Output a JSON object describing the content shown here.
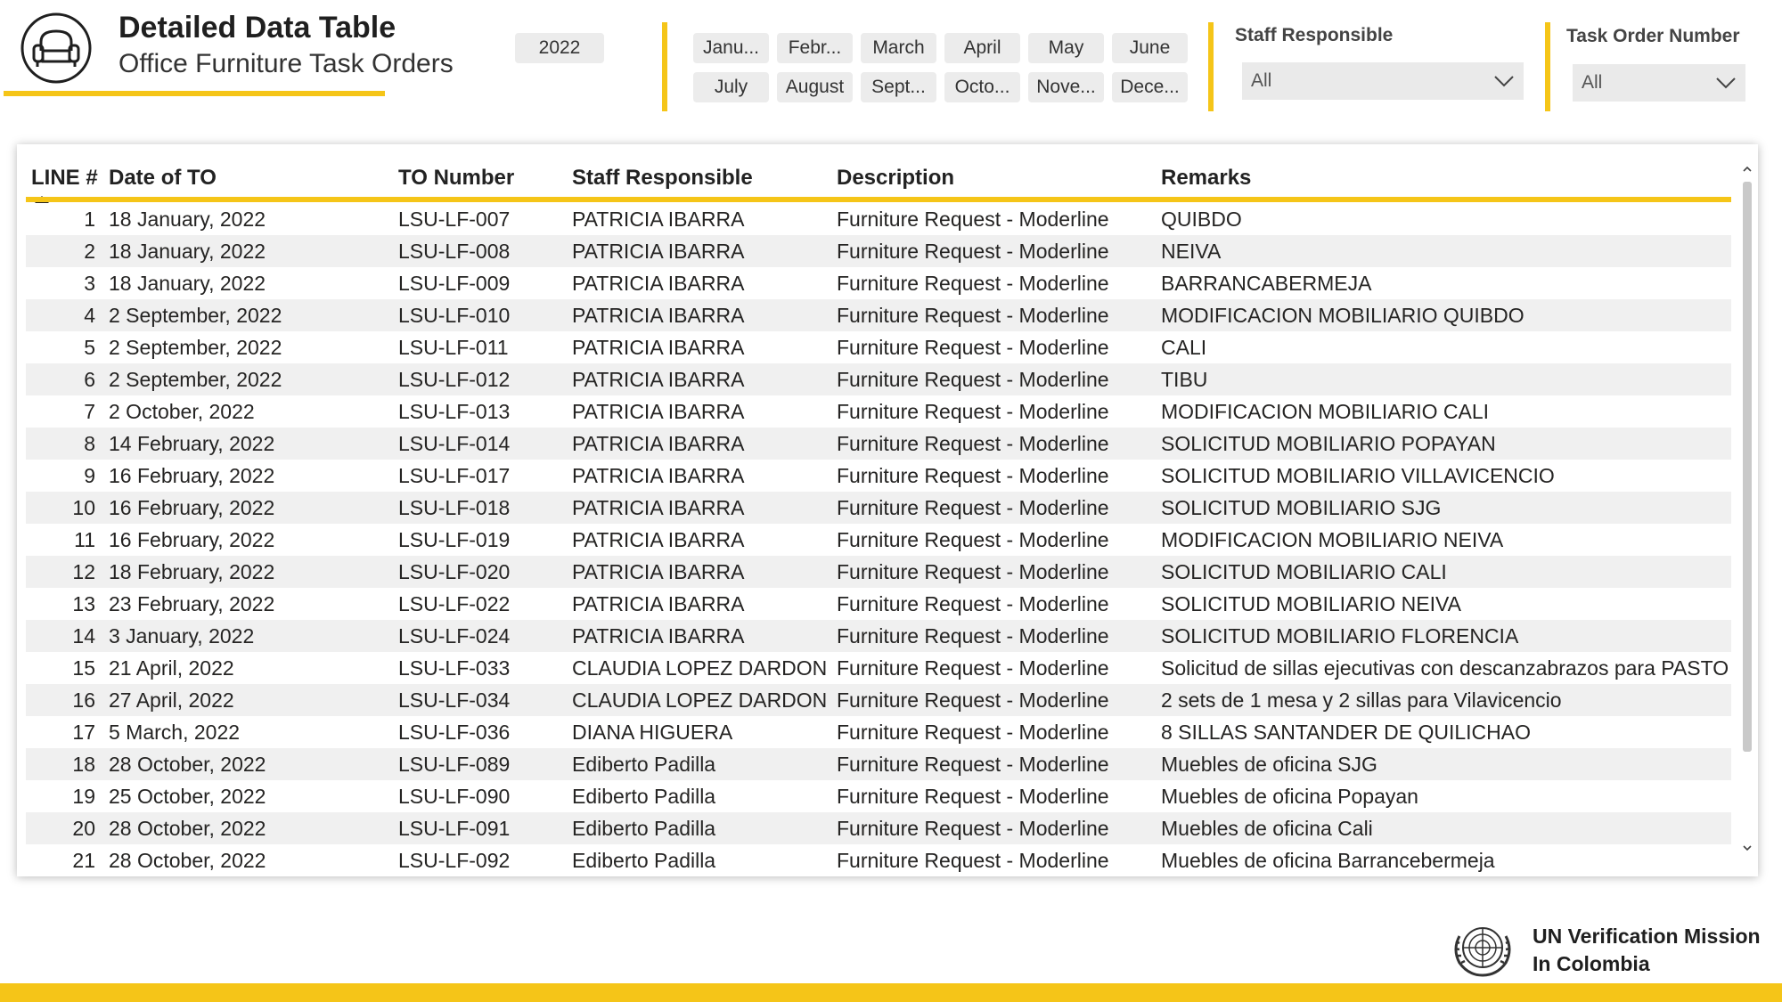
{
  "header": {
    "title": "Detailed Data Table",
    "subtitle": "Office Furniture Task Orders",
    "logo_icon": "armchair-icon"
  },
  "filters": {
    "year": "2022",
    "months": [
      "Janu...",
      "Febr...",
      "March",
      "April",
      "May",
      "June",
      "July",
      "August",
      "Sept...",
      "Octo...",
      "Nove...",
      "Dece..."
    ],
    "staff": {
      "title": "Staff Responsible",
      "value": "All"
    },
    "task_order": {
      "title": "Task Order Number",
      "value": "All"
    }
  },
  "table": {
    "columns": [
      "LINE #",
      "Date of TO",
      "TO Number",
      "Staff Responsible",
      "Description",
      "Remarks"
    ],
    "sort_column": "LINE #",
    "sort_direction": "ascending",
    "rows": [
      [
        "1",
        "18 January, 2022",
        "LSU-LF-007",
        "PATRICIA IBARRA",
        "Furniture Request - Moderline",
        "QUIBDO"
      ],
      [
        "2",
        "18 January, 2022",
        "LSU-LF-008",
        "PATRICIA IBARRA",
        "Furniture Request - Moderline",
        "NEIVA"
      ],
      [
        "3",
        "18 January, 2022",
        "LSU-LF-009",
        "PATRICIA IBARRA",
        "Furniture Request - Moderline",
        "BARRANCABERMEJA"
      ],
      [
        "4",
        "2 September, 2022",
        "LSU-LF-010",
        "PATRICIA IBARRA",
        "Furniture Request - Moderline",
        "MODIFICACION MOBILIARIO QUIBDO"
      ],
      [
        "5",
        "2 September, 2022",
        "LSU-LF-011",
        "PATRICIA IBARRA",
        "Furniture Request - Moderline",
        "CALI"
      ],
      [
        "6",
        "2 September, 2022",
        "LSU-LF-012",
        "PATRICIA IBARRA",
        "Furniture Request - Moderline",
        "TIBU"
      ],
      [
        "7",
        "2 October, 2022",
        "LSU-LF-013",
        "PATRICIA IBARRA",
        "Furniture Request - Moderline",
        "MODIFICACION MOBILIARIO CALI"
      ],
      [
        "8",
        "14 February, 2022",
        "LSU-LF-014",
        "PATRICIA IBARRA",
        "Furniture Request - Moderline",
        "SOLICITUD MOBILIARIO POPAYAN"
      ],
      [
        "9",
        "16 February, 2022",
        "LSU-LF-017",
        "PATRICIA IBARRA",
        "Furniture Request - Moderline",
        "SOLICITUD MOBILIARIO VILLAVICENCIO"
      ],
      [
        "10",
        "16 February, 2022",
        "LSU-LF-018",
        "PATRICIA IBARRA",
        "Furniture Request - Moderline",
        "SOLICITUD MOBILIARIO SJG"
      ],
      [
        "11",
        "16 February, 2022",
        "LSU-LF-019",
        "PATRICIA IBARRA",
        "Furniture Request - Moderline",
        "MODIFICACION MOBILIARIO NEIVA"
      ],
      [
        "12",
        "18 February, 2022",
        "LSU-LF-020",
        "PATRICIA IBARRA",
        "Furniture Request - Moderline",
        "SOLICITUD MOBILIARIO CALI"
      ],
      [
        "13",
        "23 February, 2022",
        "LSU-LF-022",
        "PATRICIA IBARRA",
        "Furniture Request - Moderline",
        "SOLICITUD MOBILIARIO NEIVA"
      ],
      [
        "14",
        "3 January, 2022",
        "LSU-LF-024",
        "PATRICIA IBARRA",
        "Furniture Request - Moderline",
        "SOLICITUD MOBILIARIO FLORENCIA"
      ],
      [
        "15",
        "21 April, 2022",
        "LSU-LF-033",
        "CLAUDIA LOPEZ DARDON",
        "Furniture Request - Moderline",
        "Solicitud de sillas ejecutivas con descanzabrazos para PASTO"
      ],
      [
        "16",
        "27 April, 2022",
        "LSU-LF-034",
        "CLAUDIA LOPEZ DARDON",
        "Furniture Request - Moderline",
        "2 sets de 1 mesa y 2 sillas para Vilavicencio"
      ],
      [
        "17",
        "5 March, 2022",
        "LSU-LF-036",
        "DIANA HIGUERA",
        "Furniture Request - Moderline",
        "8 SILLAS SANTANDER DE QUILICHAO"
      ],
      [
        "18",
        "28 October, 2022",
        "LSU-LF-089",
        "Ediberto Padilla",
        "Furniture Request - Moderline",
        "Muebles de oficina SJG"
      ],
      [
        "19",
        "25 October, 2022",
        "LSU-LF-090",
        "Ediberto Padilla",
        "Furniture Request - Moderline",
        "Muebles de oficina Popayan"
      ],
      [
        "20",
        "28 October, 2022",
        "LSU-LF-091",
        "Ediberto Padilla",
        "Furniture Request - Moderline",
        "Muebles de oficina Cali"
      ],
      [
        "21",
        "28 October, 2022",
        "LSU-LF-092",
        "Ediberto Padilla",
        "Furniture Request - Moderline",
        "Muebles de oficina Barrancebermeja"
      ]
    ]
  },
  "footer": {
    "org_line1": "UN Verification Mission",
    "org_line2": "In Colombia",
    "logo_icon": "un-emblem-icon"
  },
  "colors": {
    "accent": "#f5c518",
    "row_alt": "#f0f0f0",
    "chip_bg": "#ececec"
  }
}
